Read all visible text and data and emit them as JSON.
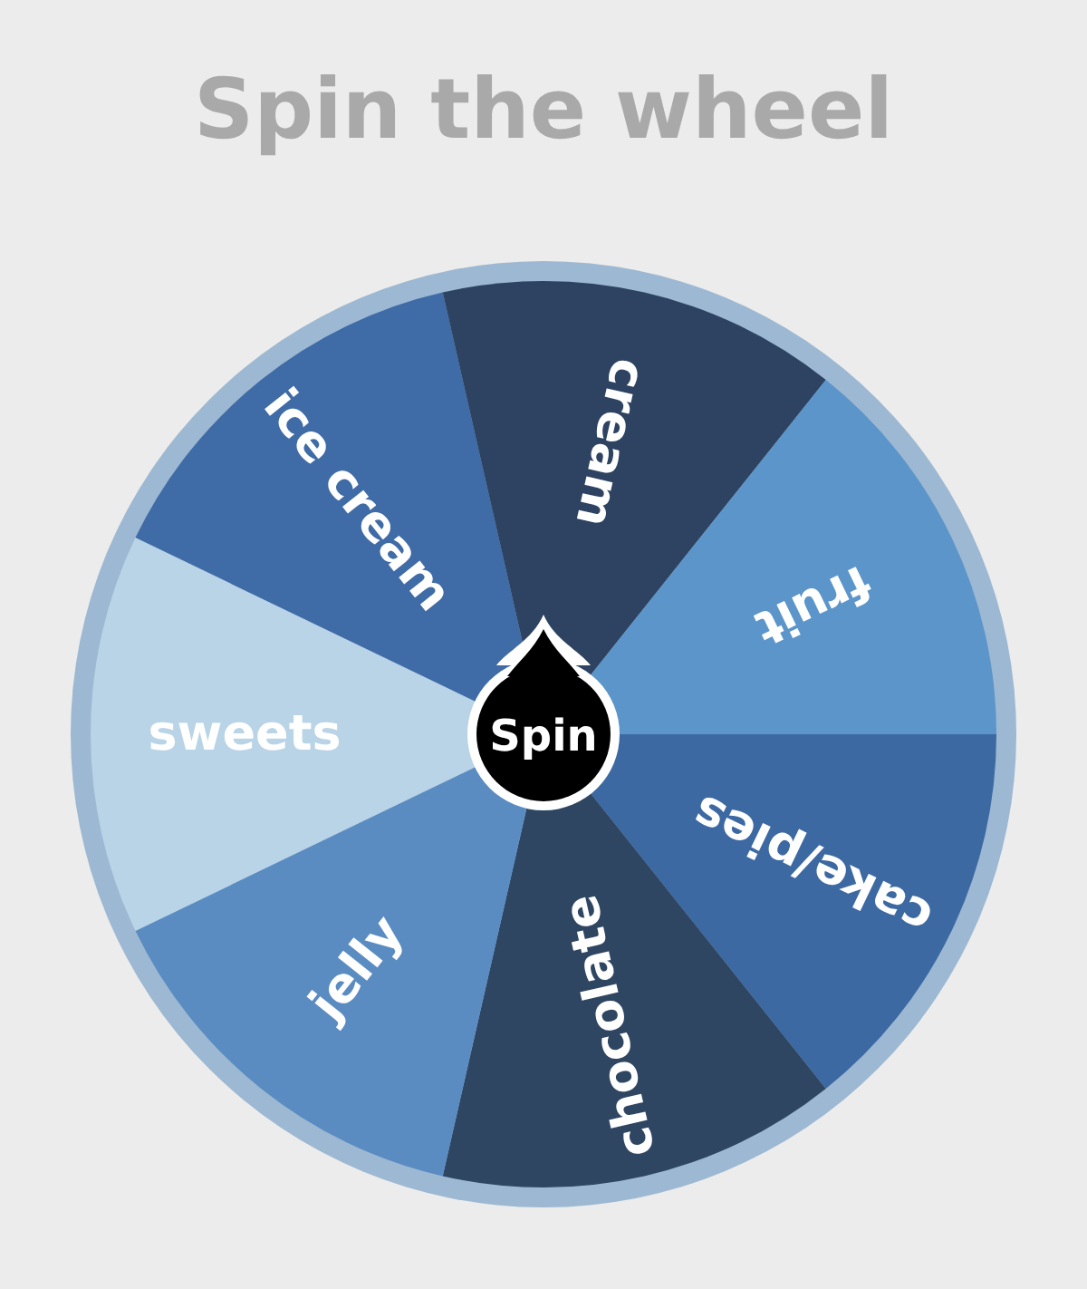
{
  "title": "Spin the wheel",
  "wheel": {
    "segments": [
      {
        "label": "cake/pies",
        "color": "#3d69a3"
      },
      {
        "label": "chocolate",
        "color": "#2f4662"
      },
      {
        "label": "jelly",
        "color": "#5a8cc2"
      },
      {
        "label": "sweets",
        "color": "#b9d3e7"
      },
      {
        "label": "ice cream",
        "color": "#3f6ba6"
      },
      {
        "label": "cream",
        "color": "#2d4361"
      },
      {
        "label": "fruit",
        "color": "#5c95c9"
      }
    ]
  },
  "spin_button": {
    "label": "Spin"
  }
}
